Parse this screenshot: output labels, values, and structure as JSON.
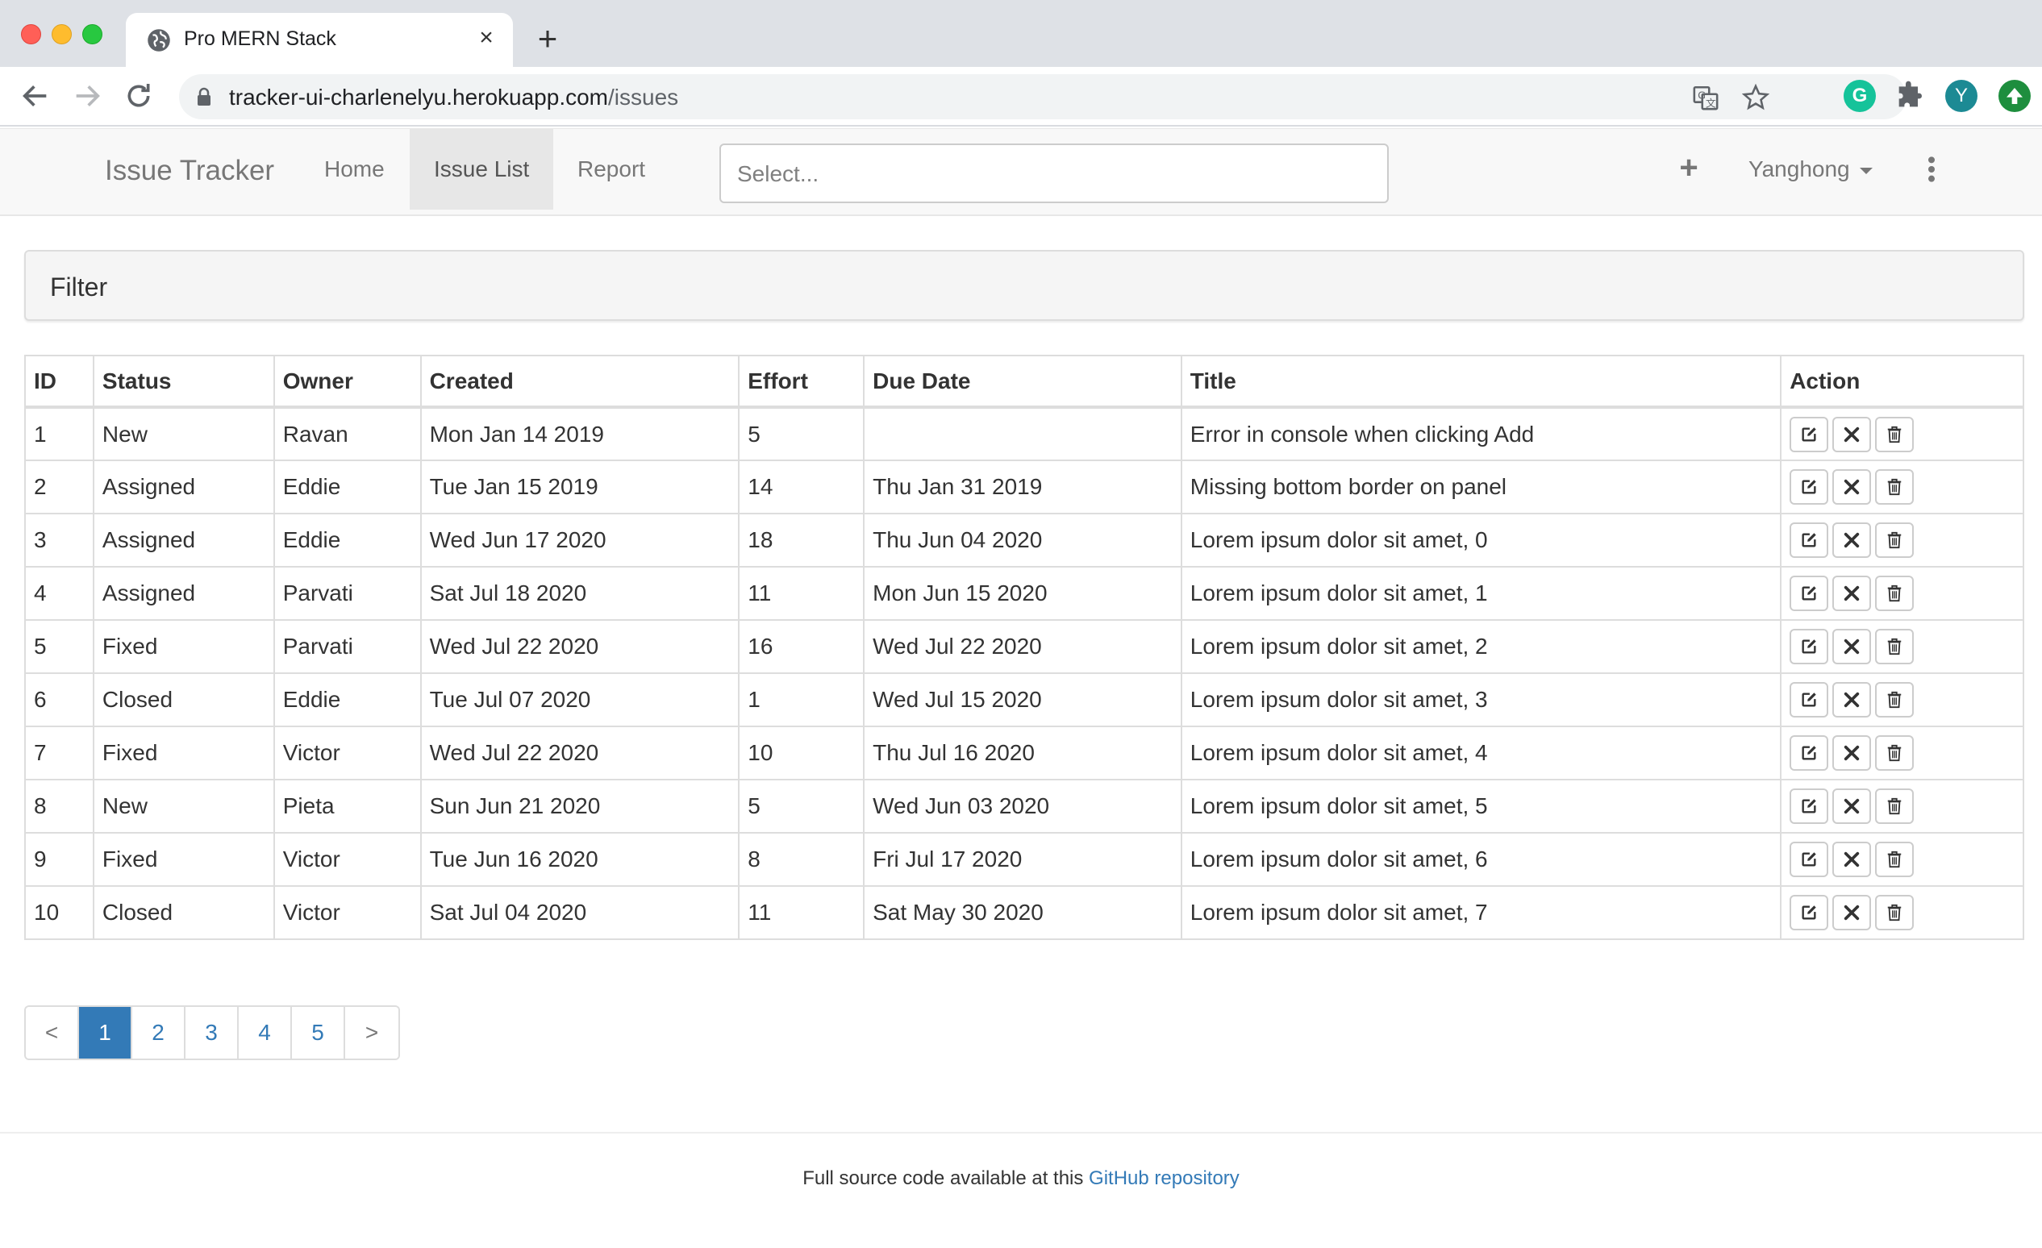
{
  "browser": {
    "tab_title": "Pro MERN Stack",
    "url_host": "tracker-ui-charlenelyu.herokuapp.com",
    "url_path": "/issues",
    "avatar_letter": "Y",
    "grammarly_letter": "G"
  },
  "app": {
    "brand": "Issue Tracker",
    "nav": {
      "home": "Home",
      "issue_list": "Issue List",
      "report": "Report"
    },
    "search_placeholder": "Select...",
    "user_name": "Yanghong"
  },
  "filter": {
    "title": "Filter"
  },
  "table": {
    "headers": [
      "ID",
      "Status",
      "Owner",
      "Created",
      "Effort",
      "Due Date",
      "Title",
      "Action"
    ],
    "rows": [
      [
        "1",
        "New",
        "Ravan",
        "Mon Jan 14 2019",
        "5",
        "",
        "Error in console when clicking Add"
      ],
      [
        "2",
        "Assigned",
        "Eddie",
        "Tue Jan 15 2019",
        "14",
        "Thu Jan 31 2019",
        "Missing bottom border on panel"
      ],
      [
        "3",
        "Assigned",
        "Eddie",
        "Wed Jun 17 2020",
        "18",
        "Thu Jun 04 2020",
        "Lorem ipsum dolor sit amet, 0"
      ],
      [
        "4",
        "Assigned",
        "Parvati",
        "Sat Jul 18 2020",
        "11",
        "Mon Jun 15 2020",
        "Lorem ipsum dolor sit amet, 1"
      ],
      [
        "5",
        "Fixed",
        "Parvati",
        "Wed Jul 22 2020",
        "16",
        "Wed Jul 22 2020",
        "Lorem ipsum dolor sit amet, 2"
      ],
      [
        "6",
        "Closed",
        "Eddie",
        "Tue Jul 07 2020",
        "1",
        "Wed Jul 15 2020",
        "Lorem ipsum dolor sit amet, 3"
      ],
      [
        "7",
        "Fixed",
        "Victor",
        "Wed Jul 22 2020",
        "10",
        "Thu Jul 16 2020",
        "Lorem ipsum dolor sit amet, 4"
      ],
      [
        "8",
        "New",
        "Pieta",
        "Sun Jun 21 2020",
        "5",
        "Wed Jun 03 2020",
        "Lorem ipsum dolor sit amet, 5"
      ],
      [
        "9",
        "Fixed",
        "Victor",
        "Tue Jun 16 2020",
        "8",
        "Fri Jul 17 2020",
        "Lorem ipsum dolor sit amet, 6"
      ],
      [
        "10",
        "Closed",
        "Victor",
        "Sat Jul 04 2020",
        "11",
        "Sat May 30 2020",
        "Lorem ipsum dolor sit amet, 7"
      ]
    ],
    "action_icons": [
      "edit-icon",
      "close-icon",
      "trash-icon"
    ]
  },
  "pagination": {
    "prev": "<",
    "pages": [
      "1",
      "2",
      "3",
      "4",
      "5"
    ],
    "active_page": "1",
    "next": ">"
  },
  "footer": {
    "text": "Full source code available at this ",
    "link_text": "GitHub repository"
  },
  "colors": {
    "link": "#337ab7",
    "active_page_bg": "#337ab7",
    "navbar_bg": "#f8f8f8"
  }
}
